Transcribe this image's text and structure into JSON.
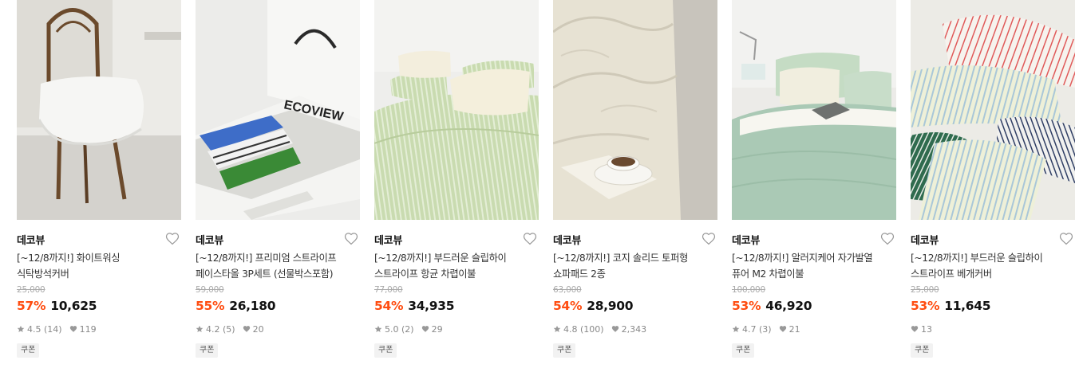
{
  "products": [
    {
      "brand": "데코뷰",
      "title_line1": "[~12/8까지!] 화이트워싱",
      "title_line2": "식탁방석커버",
      "original_price": "25,000",
      "discount": "57%",
      "price": "10,625",
      "rating": "4.5",
      "reviews": "(14)",
      "likes": "119",
      "badge": "쿠폰",
      "image": "white-ruffle-chair-cushion"
    },
    {
      "brand": "데코뷰",
      "title_line1": "[~12/8까지!] 프리미엄 스트라이프",
      "title_line2": "페이스타올 3P세트 (선물박스포함)",
      "original_price": "59,000",
      "discount": "55%",
      "price": "26,180",
      "rating": "4.2",
      "reviews": "(5)",
      "likes": "20",
      "badge": "쿠폰",
      "image": "towel-gift-box",
      "box_text": "ECOVIEW"
    },
    {
      "brand": "데코뷰",
      "title_line1": "[~12/8까지!] 부드러운 슬립하이",
      "title_line2": "스트라이프 항균 차렵이불",
      "original_price": "77,000",
      "discount": "54%",
      "price": "34,935",
      "rating": "5.0",
      "reviews": "(2)",
      "likes": "29",
      "badge": "쿠폰",
      "image": "green-striped-bedding"
    },
    {
      "brand": "데코뷰",
      "title_line1": "[~12/8까지!] 코지 솔리드 토퍼형",
      "title_line2": "쇼파패드 2종",
      "original_price": "63,000",
      "discount": "54%",
      "price": "28,900",
      "rating": "4.8",
      "reviews": "(100)",
      "likes": "2,343",
      "badge": "쿠폰",
      "image": "cream-sofa-pad-with-coffee"
    },
    {
      "brand": "데코뷰",
      "title_line1": "[~12/8까지!] 알러지케어 자가발열",
      "title_line2": "퓨어 M2 차렵이불",
      "original_price": "100,000",
      "discount": "53%",
      "price": "46,920",
      "rating": "4.7",
      "reviews": "(3)",
      "likes": "21",
      "badge": "쿠폰",
      "image": "mint-bedding-with-laptop"
    },
    {
      "brand": "데코뷰",
      "title_line1": "[~12/8까지!] 부드러운 슬립하이",
      "title_line2": "스트라이프 베개커버",
      "original_price": "25,000",
      "discount": "53%",
      "price": "11,645",
      "rating": "",
      "reviews": "",
      "likes": "13",
      "badge": "쿠폰",
      "image": "striped-pillow-covers"
    }
  ],
  "colors": {
    "discount": "#ff4d11",
    "text": "#111111",
    "muted": "#888888",
    "strike": "#aaaaaa",
    "badge_bg": "#f2f2f2"
  },
  "icons": {
    "like": "heart-outline-icon",
    "rating": "star-icon",
    "likes": "heart-filled-icon"
  }
}
